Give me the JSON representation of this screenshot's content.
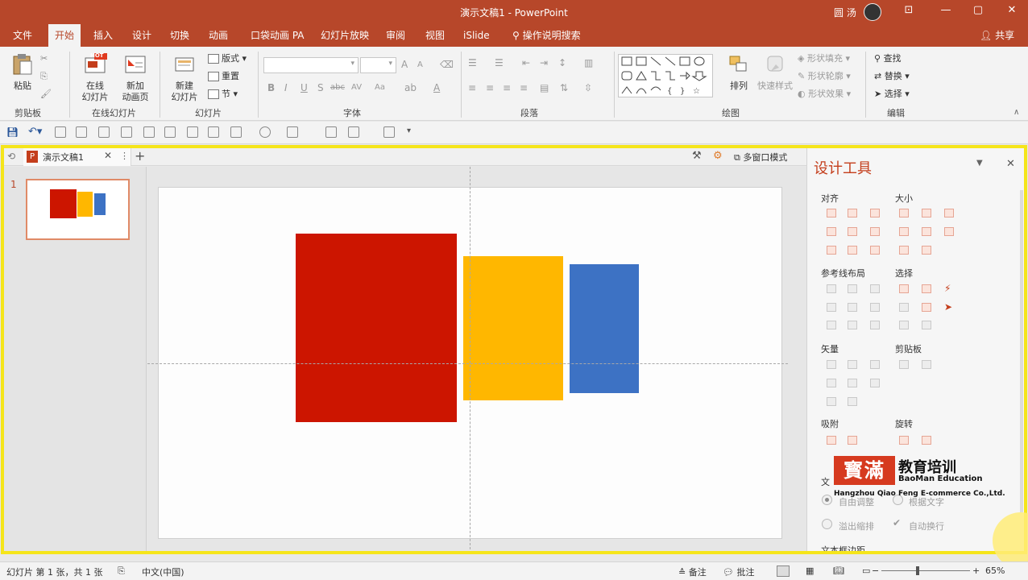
{
  "window": {
    "title": "演示文稿1  -  PowerPoint",
    "user": "圆 汤",
    "min": "—",
    "max": "▢",
    "close": "✕",
    "ribbon_toggle": "⊡"
  },
  "tabs": [
    "文件",
    "开始",
    "插入",
    "设计",
    "切换",
    "动画",
    "口袋动画 PA",
    "幻灯片放映",
    "审阅",
    "视图",
    "iSlide",
    "操作说明搜索"
  ],
  "share": "共享",
  "ribbon": {
    "clipboard": {
      "paste": "粘贴",
      "group": "剪贴板"
    },
    "online_slides": {
      "online": "在线\n幻灯片",
      "new_anim": "新加\n动画页",
      "group": "在线幻灯片",
      "hot": "HOT"
    },
    "slides": {
      "new_slide": "新建\n幻灯片",
      "layout": "版式",
      "reset": "重置",
      "section": "节",
      "group": "幻灯片"
    },
    "font": {
      "group": "字体",
      "bold": "B",
      "italic": "I",
      "underline": "U",
      "shadow": "S",
      "strike": "abc",
      "spacing": "AV",
      "size_up": "A",
      "size_down": "A",
      "case": "Aa",
      "color": "A"
    },
    "paragraph": {
      "group": "段落"
    },
    "drawing": {
      "arrange": "排列",
      "quick_styles": "快速样式",
      "fill": "形状填充",
      "outline": "形状轮廓",
      "effects": "形状效果",
      "group": "绘图"
    },
    "editing": {
      "find": "查找",
      "replace": "替换",
      "select": "选择",
      "group": "编辑"
    }
  },
  "doc_tab": {
    "name": "演示文稿1",
    "multi_window": "多窗口模式",
    "add": "+"
  },
  "thumbnail": {
    "number": "1"
  },
  "slide": {
    "shapes": [
      {
        "name": "red-rectangle",
        "color": "#cc1500"
      },
      {
        "name": "orange-rectangle",
        "color": "#ffb700"
      },
      {
        "name": "blue-rectangle",
        "color": "#3d72c4"
      }
    ]
  },
  "design_pane": {
    "title": "设计工具",
    "sections": {
      "align": "对齐",
      "size": "大小",
      "guides": "参考线布局",
      "select": "选择",
      "vector": "矢量",
      "clipboard": "剪贴板",
      "snap": "吸附",
      "rotate": "旋转",
      "text": "文",
      "text_margin": "文本框边距"
    },
    "options": {
      "free_adjust": "自由调整",
      "by_text": "根据文字",
      "overflow_shrink": "溢出缩排",
      "auto_wrap": "自动换行"
    }
  },
  "watermark": {
    "logo": "寳滿",
    "cn": "教育培训",
    "en": "BaoMan Education",
    "sub": "Hangzhou Qiao Feng E-commerce Co.,Ltd."
  },
  "status": {
    "slide_info": "幻灯片 第 1 张，共 1 张",
    "lang": "中文(中国)",
    "notes": "备注",
    "comments": "批注",
    "zoom": "65%",
    "zoom_minus": "−",
    "zoom_plus": "+"
  },
  "colors": {
    "accent": "#b7472a",
    "highlight": "#f5e51a"
  }
}
